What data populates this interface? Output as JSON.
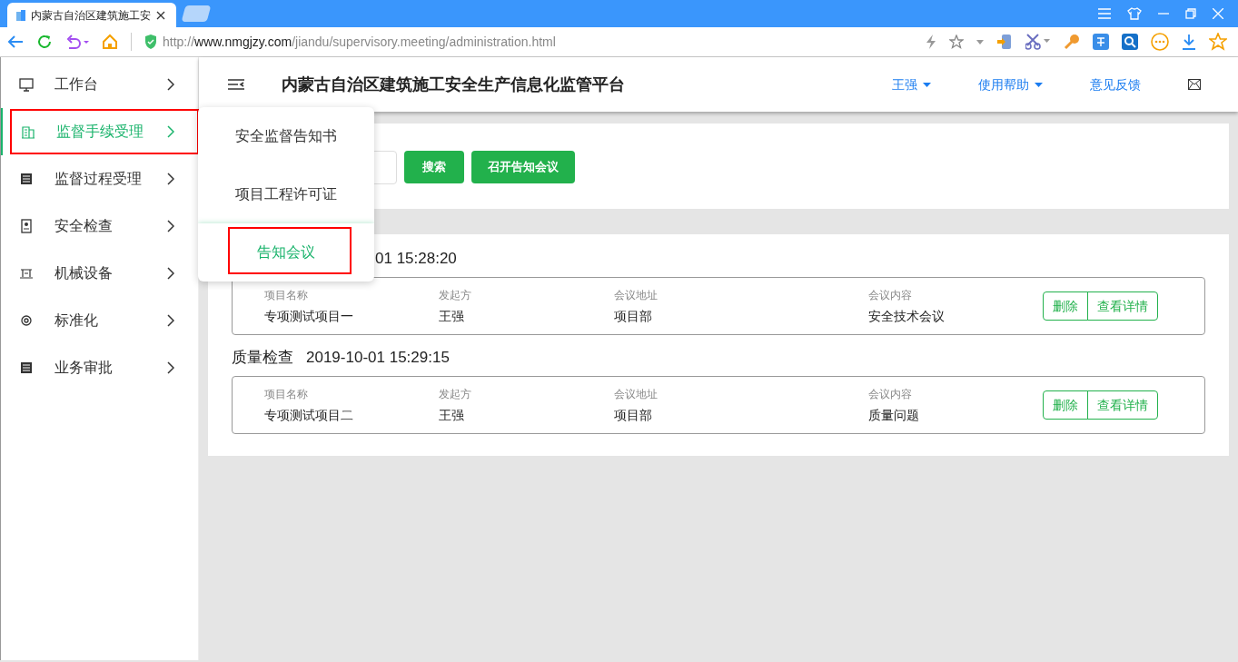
{
  "browser": {
    "tab": {
      "title": "内蒙古自治区建筑施工安"
    },
    "url": {
      "prefix": "http://",
      "host": "www.nmgjzy.com",
      "path": "/jiandu/supervisory.meeting/administration.html"
    }
  },
  "sidebar": {
    "items": [
      {
        "label": "工作台",
        "selected": false,
        "highlighted": false
      },
      {
        "label": "监督手续受理",
        "selected": true,
        "highlighted": true
      },
      {
        "label": "监督过程受理",
        "selected": false,
        "highlighted": false
      },
      {
        "label": "安全检查",
        "selected": false,
        "highlighted": false
      },
      {
        "label": "机械设备",
        "selected": false,
        "highlighted": false
      },
      {
        "label": "标准化",
        "selected": false,
        "highlighted": false
      },
      {
        "label": "业务审批",
        "selected": false,
        "highlighted": false
      }
    ]
  },
  "header": {
    "title": "内蒙古自治区建筑施工安全生产信息化监管平台",
    "menus": [
      {
        "label": "王强",
        "dropdown": true
      },
      {
        "label": "使用帮助",
        "dropdown": true
      },
      {
        "label": "意见反馈",
        "dropdown": false
      }
    ]
  },
  "submenu": {
    "items": [
      {
        "label": "安全监督告知书",
        "selected": false,
        "highlighted": false
      },
      {
        "label": "项目工程许可证",
        "selected": false,
        "highlighted": false
      },
      {
        "label": "告知会议",
        "selected": true,
        "highlighted": true
      }
    ]
  },
  "toolbar": {
    "buttons": [
      "搜索",
      "召开告知会议"
    ]
  },
  "meetings": [
    {
      "time": "01 15:28:20",
      "fields": [
        {
          "label": "项目名称",
          "value": "专项测试项目一"
        },
        {
          "label": "发起方",
          "value": "王强"
        },
        {
          "label": "会议地址",
          "value": "项目部"
        },
        {
          "label": "会议内容",
          "value": "安全技术会议"
        }
      ],
      "actions": [
        "删除",
        "查看详情"
      ]
    },
    {
      "title": "质量检查",
      "time": "2019-10-01 15:29:15",
      "fields": [
        {
          "label": "项目名称",
          "value": "专项测试项目二"
        },
        {
          "label": "发起方",
          "value": "王强"
        },
        {
          "label": "会议地址",
          "value": "项目部"
        },
        {
          "label": "会议内容",
          "value": "质量问题"
        }
      ],
      "actions": [
        "删除",
        "查看详情"
      ]
    }
  ]
}
